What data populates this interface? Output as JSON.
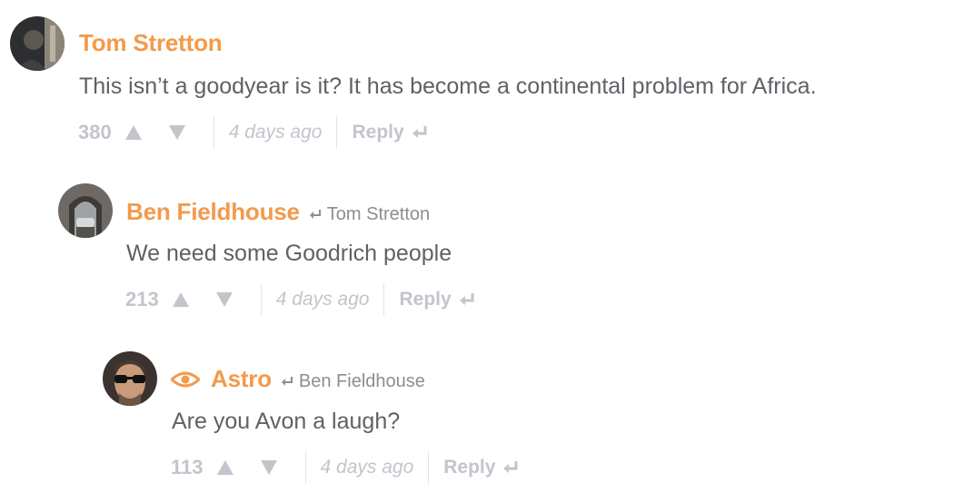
{
  "comments": [
    {
      "author": "Tom Stretton",
      "reply_to": "",
      "text": "This isn’t a goodyear is it? It has become a continental problem for Africa.",
      "score": "380",
      "time": "4 days ago",
      "reply_label": "Reply"
    },
    {
      "author": "Ben Fieldhouse",
      "reply_to": "Tom Stretton",
      "text": "We need some Goodrich people",
      "score": "213",
      "time": "4 days ago",
      "reply_label": "Reply"
    },
    {
      "author": "Astro",
      "reply_to": "Ben Fieldhouse",
      "text": "Are you Avon a laugh?",
      "score": "113",
      "time": "4 days ago",
      "reply_label": "Reply"
    }
  ],
  "colors": {
    "author": "#f39a4b",
    "body_text": "#5f6166",
    "meta": "#c2c5cc",
    "reply_to": "#8b8e93"
  },
  "icons": {
    "upvote": "triangle-up-icon",
    "downvote": "triangle-down-icon",
    "reply": "reply-arrow-icon",
    "badge": "eye-icon"
  }
}
